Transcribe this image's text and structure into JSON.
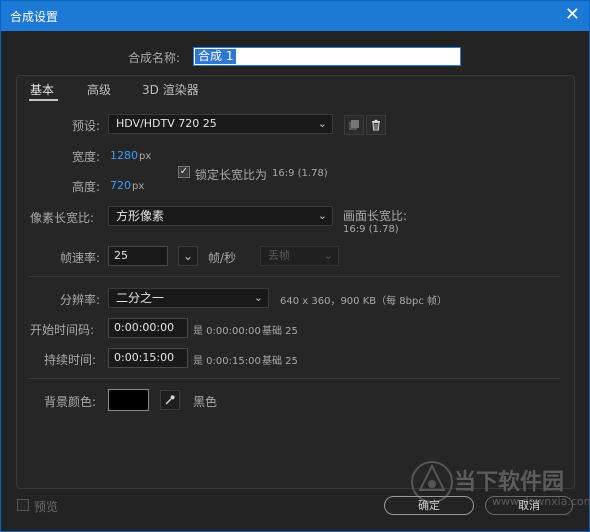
{
  "window": {
    "title": "合成设置",
    "close_glyph": "✕"
  },
  "comp_name": {
    "label": "合成名称:",
    "value": "合成 1"
  },
  "tabs": [
    {
      "label": "基本"
    },
    {
      "label": "高级"
    },
    {
      "label": "3D 渲染器"
    }
  ],
  "preset": {
    "label": "预设:",
    "value": "HDV/HDTV 720 25"
  },
  "width": {
    "label": "宽度:",
    "value": "1280",
    "unit": "px"
  },
  "height": {
    "label": "高度:",
    "value": "720",
    "unit": "px"
  },
  "lock_aspect": {
    "checked": true,
    "label": "锁定长宽比为",
    "value": "16:9 (1.78)"
  },
  "pixel_aspect": {
    "label": "像素长宽比:",
    "value": "方形像素",
    "frame_aspect_label": "画面长宽比:",
    "frame_aspect_value": "16:9 (1.78)"
  },
  "frame_rate": {
    "label": "帧速率:",
    "value": "25",
    "unit": "帧/秒",
    "drop_frame": "丢帧"
  },
  "resolution": {
    "label": "分辨率:",
    "value": "二分之一",
    "info": "640 x 360，900 KB（每 8bpc 帧）"
  },
  "start_timecode": {
    "label": "开始时间码:",
    "value": "0:00:00:00",
    "is": "是 0:00:00:00",
    "base": "基础 25"
  },
  "duration": {
    "label": "持续时间:",
    "value": "0:00:15:00",
    "is": "是 0:00:15:00",
    "base": "基础 25"
  },
  "bg_color": {
    "label": "背景颜色:",
    "color": "#000000",
    "name": "黑色"
  },
  "preview": {
    "label": "预览",
    "checked": false
  },
  "buttons": {
    "ok": "确定",
    "cancel": "取消"
  },
  "watermark": {
    "line1": "当下软件园",
    "line2": "www.downxia.com"
  },
  "colors": {
    "titlebar": "#1c79d6",
    "accent": "#3a9ef5",
    "background": "#232323"
  }
}
